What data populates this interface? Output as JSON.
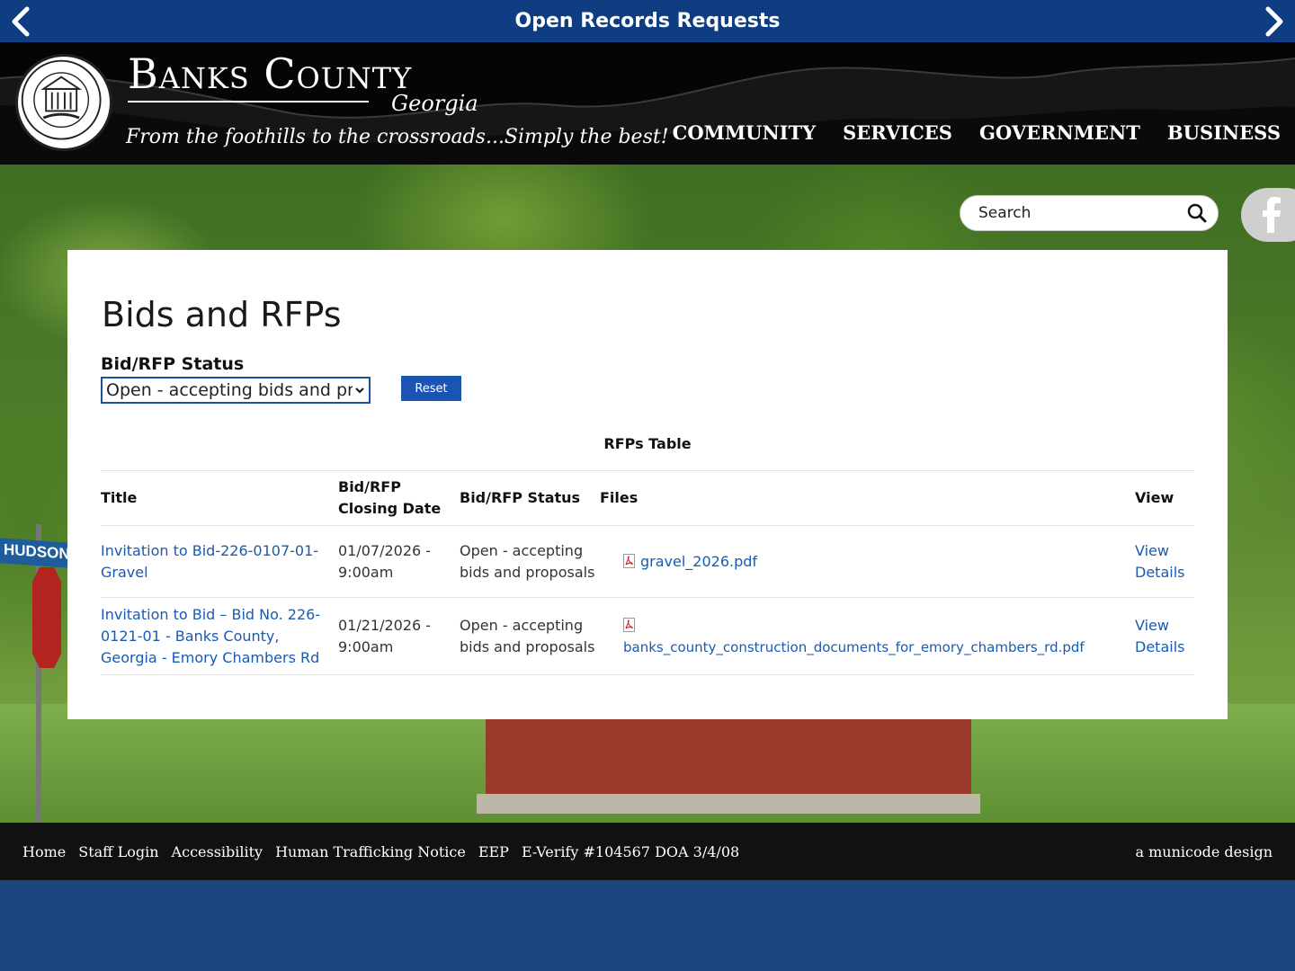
{
  "alert": {
    "title": "Open Records Requests",
    "prev_icon": "chevron-left-icon",
    "next_icon": "chevron-right-icon"
  },
  "header": {
    "brand_name": "Banks County",
    "brand_state": "Georgia",
    "tagline": "From the foothills to the crossroads...Simply the best!",
    "seal_icon": "county-seal-logo",
    "nav": [
      "COMMUNITY",
      "SERVICES",
      "GOVERNMENT",
      "BUSINESS"
    ]
  },
  "search": {
    "placeholder": "Search",
    "icon": "search-icon"
  },
  "social": {
    "icon": "facebook-icon"
  },
  "hero": {
    "street_sign": "HUDSON RI"
  },
  "main": {
    "title": "Bids and RFPs",
    "filter_label": "Bid/RFP Status",
    "filter_selected": "Open - accepting bids and proposals",
    "reset_label": "Reset",
    "table_caption": "RFPs Table",
    "columns": {
      "title": "Title",
      "closing_date": "Bid/RFP Closing Date",
      "status": "Bid/RFP Status",
      "files": "Files",
      "view": "View"
    },
    "rows": [
      {
        "title": "Invitation to Bid-226-0107-01-Gravel",
        "closing_date": "01/07/2026 - 9:00am",
        "status": "Open - accepting bids and proposals",
        "file": "gravel_2026.pdf",
        "view": "View Details"
      },
      {
        "title": "Invitation to Bid – Bid No. 226-0121-01 - Banks County, Georgia - Emory Chambers Rd",
        "closing_date": "01/21/2026 - 9:00am",
        "status": "Open - accepting bids and proposals",
        "file": "banks_county_construction_documents_for_emory_chambers_rd.pdf",
        "view": "View Details"
      }
    ]
  },
  "footer": {
    "links": [
      "Home",
      "Staff Login",
      "Accessibility",
      "Human Trafficking Notice",
      "EEP",
      "E-Verify #104567 DOA 3/4/08"
    ],
    "credit": "a municode design"
  },
  "colors": {
    "alert_bar": "#0f3d82",
    "header_bg": "#050505",
    "link": "#1a5ab0",
    "button": "#1a55b4",
    "footer_bg": "#111111",
    "page_bottom": "#1d4580"
  }
}
